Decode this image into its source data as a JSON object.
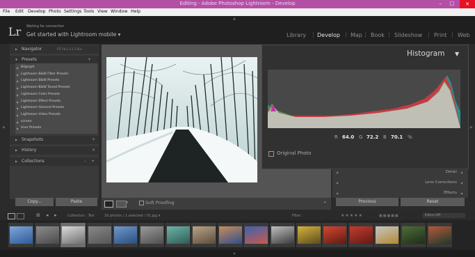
{
  "window": {
    "title": "Editing - Adobe Photoshop Lightroom - Develop",
    "controls": [
      "–",
      "□",
      "✕"
    ]
  },
  "menu": [
    "File",
    "Edit",
    "Develop",
    "Photo",
    "Settings",
    "Tools",
    "View",
    "Window",
    "Help"
  ],
  "identity": {
    "logo": "Lr",
    "status": "Waiting for connection",
    "cta": "Get started with Lightroom mobile ▾"
  },
  "modules": [
    "Library",
    "Develop",
    "Map",
    "Book",
    "Slideshow",
    "Print",
    "Web"
  ],
  "active_module": "Develop",
  "left_panel": {
    "navigator": {
      "label": "Navigator",
      "zoom": "FIT  FILL  1:1  1:8 ▾"
    },
    "presets_label": "Presets",
    "presets": [
      "Bilgraph",
      "Lightroom B&W Filter Presets",
      "Lightroom B&W Presets",
      "Lightroom B&W Toned Presets",
      "Lightroom Color Presets",
      "Lightroom Effect Presets",
      "Lightroom General Presets",
      "Lightroom Video Presets",
      "screen",
      "User Presets"
    ],
    "snapshots": "Snapshots",
    "history": "History",
    "collections": "Collections",
    "copy": "Copy...",
    "paste": "Paste"
  },
  "toolbar": {
    "soft_proofing": "Soft Proofing"
  },
  "histogram": {
    "title": "Histogram",
    "r_label": "R",
    "r_value": "64.0",
    "g_label": "G",
    "g_value": "72.2",
    "b_label": "B",
    "b_value": "70.1",
    "pct": "%",
    "original_photo": "Original Photo"
  },
  "right_panel": {
    "items": [
      "Detail",
      "Lens Corrections",
      "Effects"
    ],
    "previous": "Previous",
    "reset": "Reset"
  },
  "filmstrip": {
    "collection": "Collection : Ted",
    "count": "16 photos / 1 selected / 01.jpg ▾",
    "filter_label": "Filter :",
    "filter_value": "Filters Off",
    "thumbs": [
      {
        "c1": "#7fa7d8",
        "c2": "#2d5a9a"
      },
      {
        "c1": "#8c8c8c",
        "c2": "#4a4a4a"
      },
      {
        "c1": "#dcdcdc",
        "c2": "#6e6e6e"
      },
      {
        "c1": "#888",
        "c2": "#555"
      },
      {
        "c1": "#6f98c9",
        "c2": "#2a4f80"
      },
      {
        "c1": "#9a9a9a",
        "c2": "#4f4f4f"
      },
      {
        "c1": "#6db4a8",
        "c2": "#2d5c55"
      },
      {
        "c1": "#b7a488",
        "c2": "#5d4c3a"
      },
      {
        "c1": "#c88d5c",
        "c2": "#2f4e8c"
      },
      {
        "c1": "#3e62b1",
        "c2": "#c85b4b"
      },
      {
        "c1": "#bfbfbf",
        "c2": "#3a3a3a"
      },
      {
        "c1": "#d6b23c",
        "c2": "#5b4c1e"
      },
      {
        "c1": "#d34733",
        "c2": "#5e1a12"
      },
      {
        "c1": "#c43b2f",
        "c2": "#621a14"
      },
      {
        "c1": "#c5c5c5",
        "c2": "#b08a32"
      },
      {
        "c1": "#4c6e3a",
        "c2": "#1f2d18"
      },
      {
        "c1": "#b7583a",
        "c2": "#1e3a2a"
      }
    ]
  }
}
